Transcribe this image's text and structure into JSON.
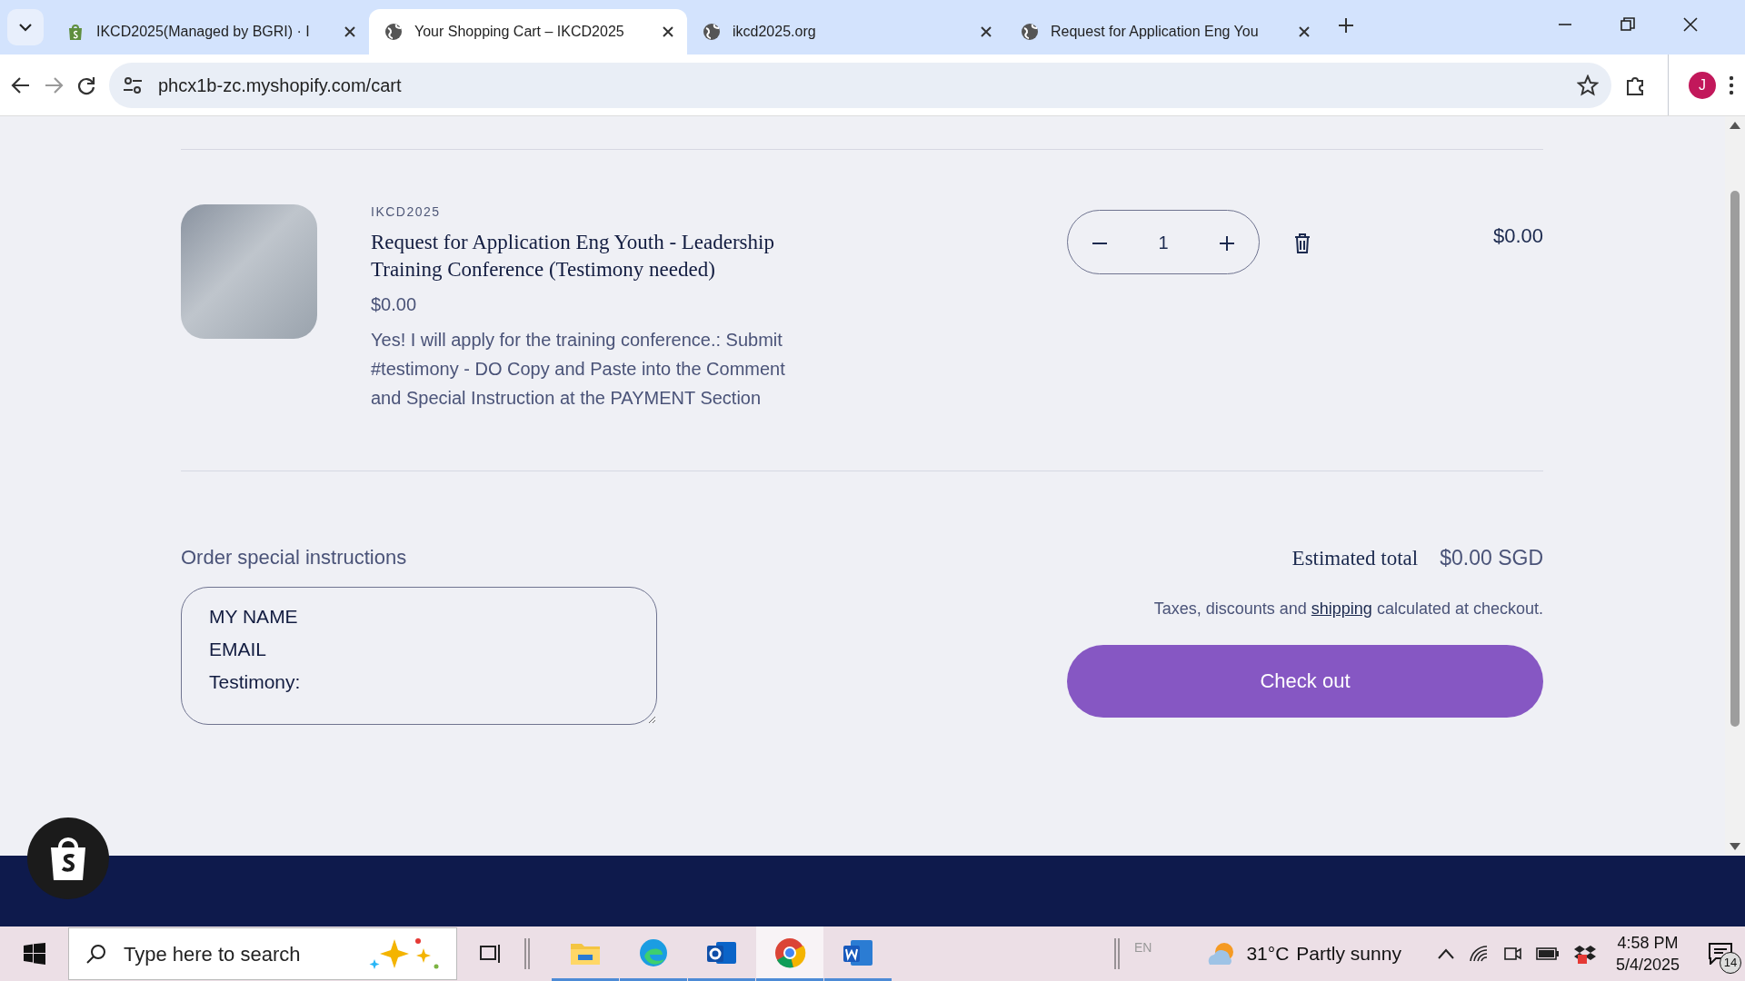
{
  "browser": {
    "tabs": [
      {
        "title": "IKCD2025(Managed by BGRI) · I",
        "kind": "shop",
        "selected": false
      },
      {
        "title": "Your Shopping Cart – IKCD2025",
        "kind": "globe",
        "selected": true
      },
      {
        "title": "ikcd2025.org",
        "kind": "globe",
        "selected": false
      },
      {
        "title": "Request for Application Eng You",
        "kind": "globe",
        "selected": false
      }
    ],
    "address": "phcx1b-zc.myshopify.com/cart",
    "profile": "J"
  },
  "cart": {
    "items": [
      {
        "vendor": "IKCD2025",
        "title": "Request for Application Eng Youth - Leadership Training Conference (Testimony needed)",
        "price": "$0.00",
        "note": "Yes! I will apply for the training conference.: Submit #testimony - DO Copy and Paste into the Comment and Special Instruction at the PAYMENT Section",
        "quantity": "1",
        "total": "$0.00"
      }
    ],
    "instructions": {
      "label": "Order special instructions",
      "value": "MY NAME\nEMAIL\nTestimony:"
    },
    "estimated_label": "Estimated total",
    "estimated_value": "$0.00 SGD",
    "tax_note": {
      "before": "Taxes, discounts and",
      "link": "shipping",
      "after": "calculated at checkout."
    },
    "checkout": "Check out"
  },
  "taskbar": {
    "search_placeholder": "Type here to search",
    "apps": [
      {
        "kind": "folder",
        "selected": false
      },
      {
        "kind": "edge",
        "selected": false
      },
      {
        "kind": "outlook",
        "selected": false
      },
      {
        "kind": "chrome",
        "selected": true
      },
      {
        "kind": "word",
        "selected": false
      }
    ],
    "language": "EN",
    "temperature": "31°C",
    "weather": "Partly sunny",
    "time": "4:58 PM",
    "date": "5/4/2025",
    "notifications": "14"
  }
}
